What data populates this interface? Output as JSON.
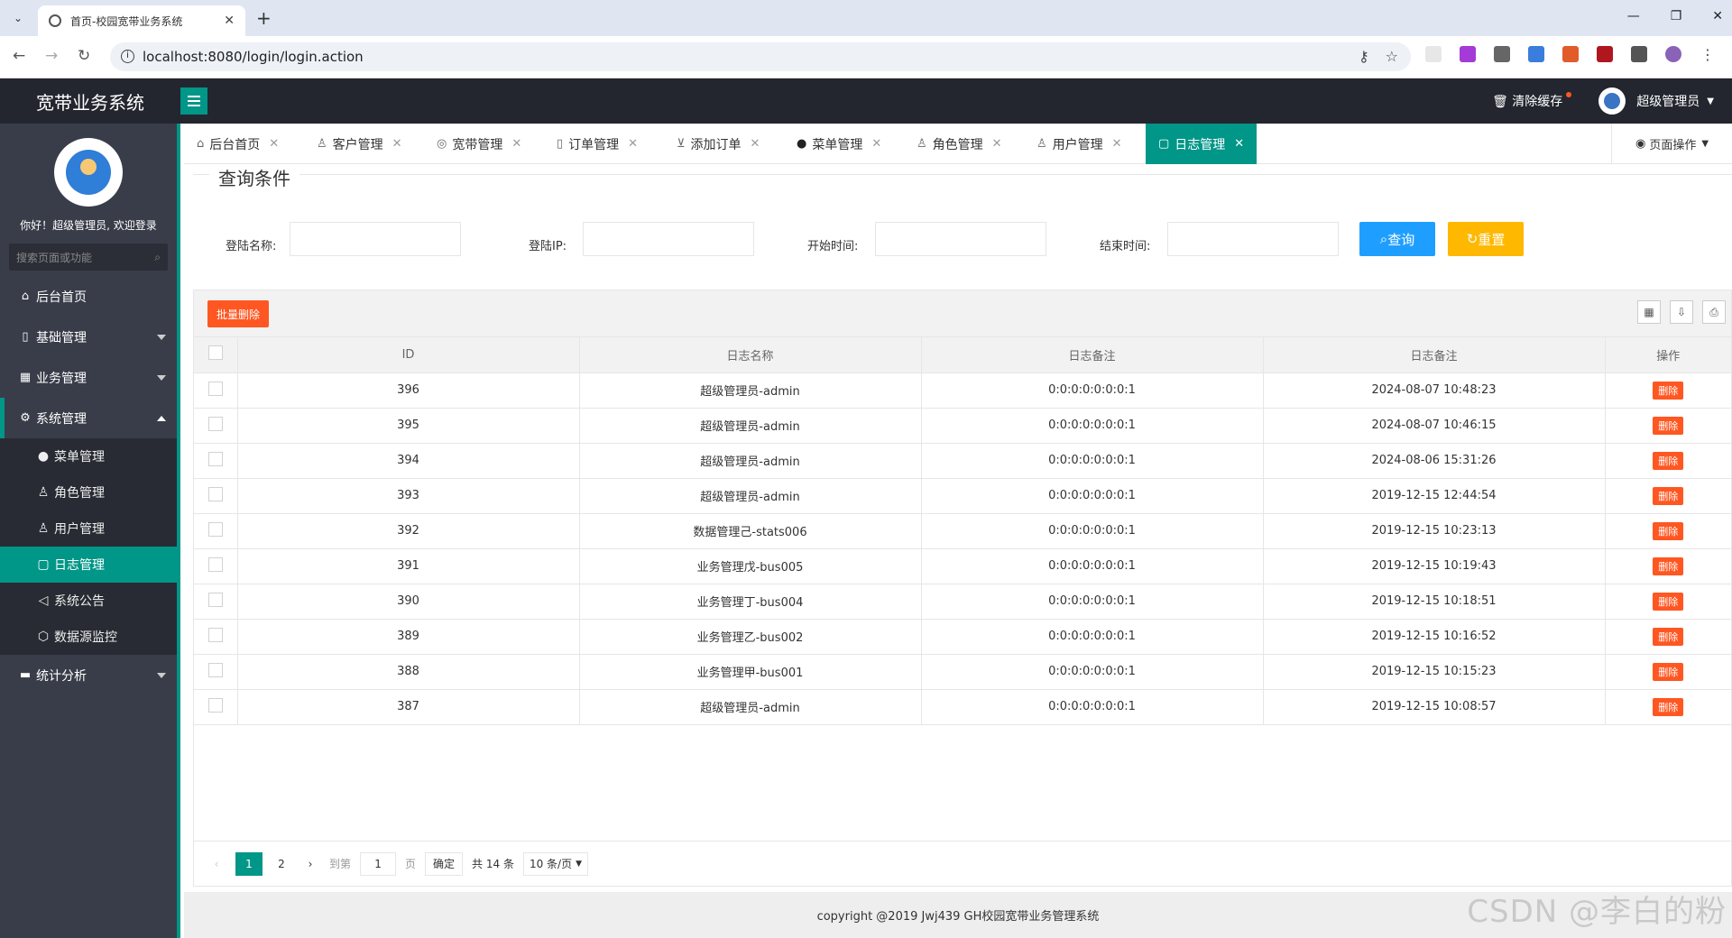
{
  "browser": {
    "tab_title": "首页-校园宽带业务系统",
    "url": "localhost:8080/login/login.action"
  },
  "header": {
    "logo": "宽带业务系统",
    "clear_cache": "清除缓存",
    "user": "超级管理员"
  },
  "sidebar": {
    "welcome": "你好！超级管理员, 欢迎登录",
    "search_placeholder": "搜索页面或功能",
    "items": [
      {
        "label": "后台首页"
      },
      {
        "label": "基础管理"
      },
      {
        "label": "业务管理"
      },
      {
        "label": "系统管理"
      },
      {
        "label": "统计分析"
      }
    ],
    "sub_items": [
      {
        "label": "菜单管理"
      },
      {
        "label": "角色管理"
      },
      {
        "label": "用户管理"
      },
      {
        "label": "日志管理"
      },
      {
        "label": "系统公告"
      },
      {
        "label": "数据源监控"
      }
    ]
  },
  "page_tabs": [
    {
      "label": "后台首页"
    },
    {
      "label": "客户管理"
    },
    {
      "label": "宽带管理"
    },
    {
      "label": "订单管理"
    },
    {
      "label": "添加订单"
    },
    {
      "label": "菜单管理"
    },
    {
      "label": "角色管理"
    },
    {
      "label": "用户管理"
    },
    {
      "label": "日志管理"
    }
  ],
  "page_ops": "页面操作",
  "query": {
    "legend": "查询条件",
    "login_name_label": "登陆名称:",
    "login_ip_label": "登陆IP:",
    "start_time_label": "开始时间:",
    "end_time_label": "结束时间:",
    "search_btn": "查询",
    "reset_btn": "重置"
  },
  "toolbar": {
    "batch_delete": "批量删除"
  },
  "table": {
    "headers": [
      "ID",
      "日志名称",
      "日志备注",
      "日志备注",
      "操作"
    ],
    "delete_label": "删除",
    "rows": [
      {
        "id": "396",
        "name": "超级管理员-admin",
        "ip": "0:0:0:0:0:0:0:1",
        "time": "2024-08-07 10:48:23"
      },
      {
        "id": "395",
        "name": "超级管理员-admin",
        "ip": "0:0:0:0:0:0:0:1",
        "time": "2024-08-07 10:46:15"
      },
      {
        "id": "394",
        "name": "超级管理员-admin",
        "ip": "0:0:0:0:0:0:0:1",
        "time": "2024-08-06 15:31:26"
      },
      {
        "id": "393",
        "name": "超级管理员-admin",
        "ip": "0:0:0:0:0:0:0:1",
        "time": "2019-12-15 12:44:54"
      },
      {
        "id": "392",
        "name": "数据管理己-stats006",
        "ip": "0:0:0:0:0:0:0:1",
        "time": "2019-12-15 10:23:13"
      },
      {
        "id": "391",
        "name": "业务管理戊-bus005",
        "ip": "0:0:0:0:0:0:0:1",
        "time": "2019-12-15 10:19:43"
      },
      {
        "id": "390",
        "name": "业务管理丁-bus004",
        "ip": "0:0:0:0:0:0:0:1",
        "time": "2019-12-15 10:18:51"
      },
      {
        "id": "389",
        "name": "业务管理乙-bus002",
        "ip": "0:0:0:0:0:0:0:1",
        "time": "2019-12-15 10:16:52"
      },
      {
        "id": "388",
        "name": "业务管理甲-bus001",
        "ip": "0:0:0:0:0:0:0:1",
        "time": "2019-12-15 10:15:23"
      },
      {
        "id": "387",
        "name": "超级管理员-admin",
        "ip": "0:0:0:0:0:0:0:1",
        "time": "2019-12-15 10:08:57"
      }
    ]
  },
  "pager": {
    "page1": "1",
    "page2": "2",
    "goto": "到第",
    "goto_value": "1",
    "page_unit": "页",
    "confirm": "确定",
    "total": "共 14 条",
    "per_page": "10 条/页"
  },
  "footer": "copyright @2019 Jwj439 GH校园宽带业务管理系统",
  "watermark": "CSDN @李白的粉",
  "colors": {
    "accent": "#009688",
    "danger": "#ff5722",
    "warn": "#ffb800",
    "info": "#1e9fff"
  }
}
